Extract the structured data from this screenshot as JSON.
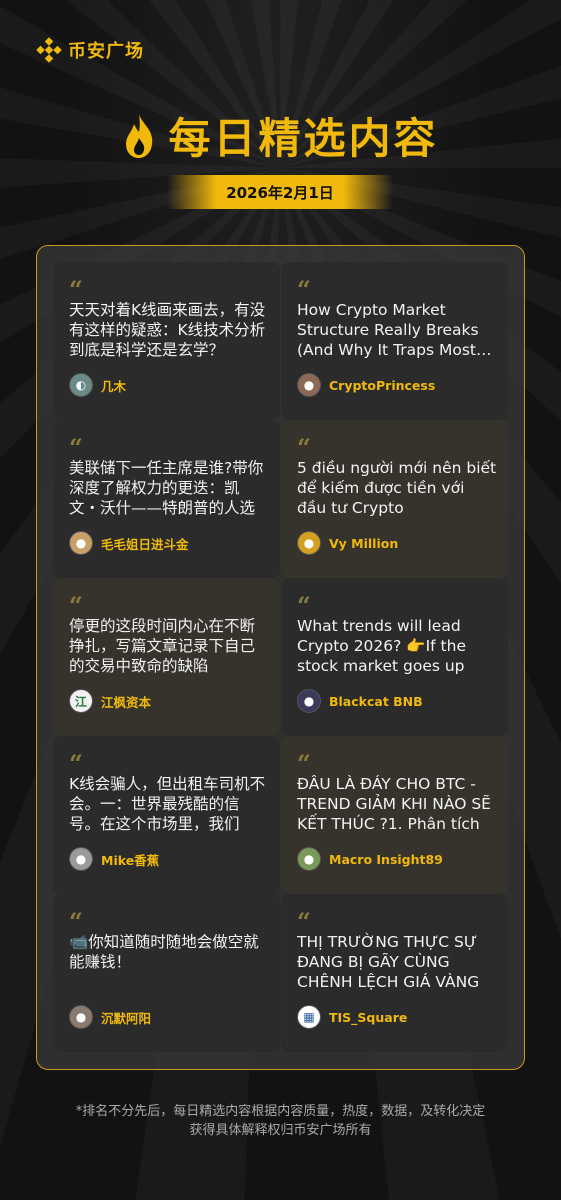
{
  "brand": {
    "name": "币安广场",
    "icon": "binance-logo-icon"
  },
  "headline": {
    "title": "每日精选内容",
    "icon": "flame-icon"
  },
  "date": "2026年2月1日",
  "colors": {
    "accent": "#F0B90B",
    "background": "#121212",
    "card": "#2b2b2b",
    "card_alt": "#35332c",
    "text_muted": "#a9a9a9"
  },
  "cards": [
    {
      "text": "天天对着K线画来画去，有没有这样的疑惑：K线技术分析到底是科学还是玄学？",
      "author": "几木",
      "avatar": "avatar-icon"
    },
    {
      "text": "How Crypto Market Structure Really Breaks (And Why It Traps Most Traders)",
      "author": "CryptoPrincess",
      "avatar": "avatar-icon"
    },
    {
      "text": "美联储下一任主席是谁?带你深度了解权力的更迭：凯文・沃什——特朗普的人选",
      "author": "毛毛姐日进斗金",
      "avatar": "avatar-icon"
    },
    {
      "text": "5 điều người mới nên biết để kiếm được tiền với đầu tư Crypto",
      "author": "Vy Million",
      "avatar": "avatar-icon"
    },
    {
      "text": "停更的这段时间内心在不断挣扎，写篇文章记录下自己的交易中致命的缺陷",
      "author": "江枫资本",
      "avatar": "avatar-icon"
    },
    {
      "text": "What trends will lead Crypto 2026? 👉If the stock market goes up",
      "author": "Blackcat BNB",
      "avatar": "avatar-icon"
    },
    {
      "text": "K线会骗人，但出租车司机不会。一：世界最残酷的信号。在这个市场里，我们",
      "author": "Mike香蕉",
      "avatar": "avatar-icon"
    },
    {
      "text": "ĐÂU LÀ ĐÁY CHO BTC - TREND GIẢM KHI NÀO SẼ KẾT THÚC ?1. Phân tích",
      "author": "Macro Insight89",
      "avatar": "avatar-icon"
    },
    {
      "text": "📹你知道随时随地会做空就能赚钱！",
      "author": "沉默阿阳",
      "avatar": "avatar-icon"
    },
    {
      "text": "THỊ TRƯỜNG THỰC SỰ ĐANG BỊ GÃY CÙNG CHÊNH LỆCH GIÁ VÀNG",
      "author": "TIS_Square",
      "avatar": "avatar-icon"
    }
  ],
  "footnote": {
    "line1": "*排名不分先后，每日精选内容根据内容质量，热度，数据，及转化决定",
    "line2": "获得具体解释权归币安广场所有"
  }
}
